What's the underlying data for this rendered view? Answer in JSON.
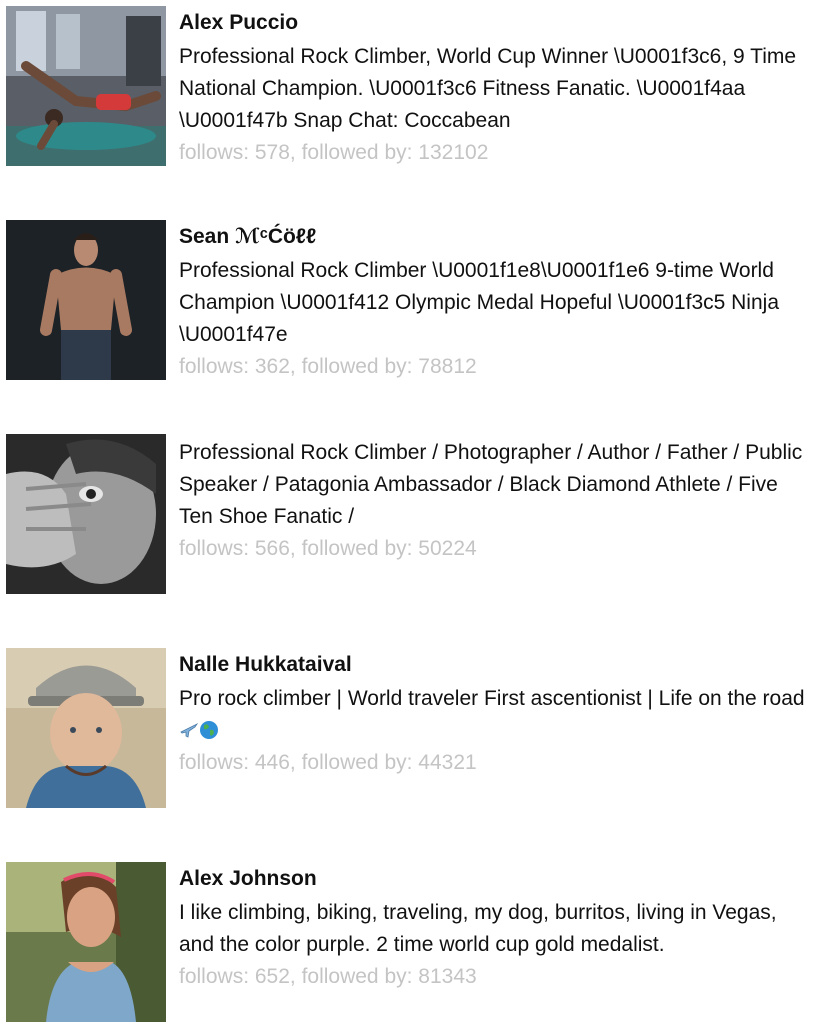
{
  "profiles": [
    {
      "name": "Alex Puccio",
      "bio": "Professional Rock Climber, World Cup Winner \\U0001f3c6, 9 Time National Champion. \\U0001f3c6 Fitness Fanatic. \\U0001f4aa \\U0001f47b Snap Chat: Coccabean",
      "stats": "follows: 578, followed by: 132102"
    },
    {
      "name": "Sean ℳᶜĆöℓℓ",
      "bio": "Professional Rock Climber \\U0001f1e8\\U0001f1e6 9-time World Champion \\U0001f412 Olympic Medal Hopeful \\U0001f3c5 Ninja \\U0001f47e",
      "stats": "follows: 362, followed by: 78812"
    },
    {
      "name": "",
      "bio": "Professional Rock Climber / Photographer / Author / Father / Public Speaker / Patagonia Ambassador / Black Diamond Athlete / Five Ten Shoe Fanatic /",
      "stats": "follows: 566, followed by: 50224"
    },
    {
      "name": "Nalle Hukkataival",
      "bio": "Pro rock climber | World traveler First ascentionist | Life on the road",
      "emojis": [
        "airplane-emoji",
        "globe-emoji"
      ],
      "stats": "follows: 446, followed by: 44321"
    },
    {
      "name": "Alex Johnson",
      "bio": "I like climbing, biking, traveling, my dog, burritos, living in Vegas, and the color purple. 2 time world cup gold medalist.",
      "stats": "follows: 652, followed by: 81343"
    }
  ]
}
